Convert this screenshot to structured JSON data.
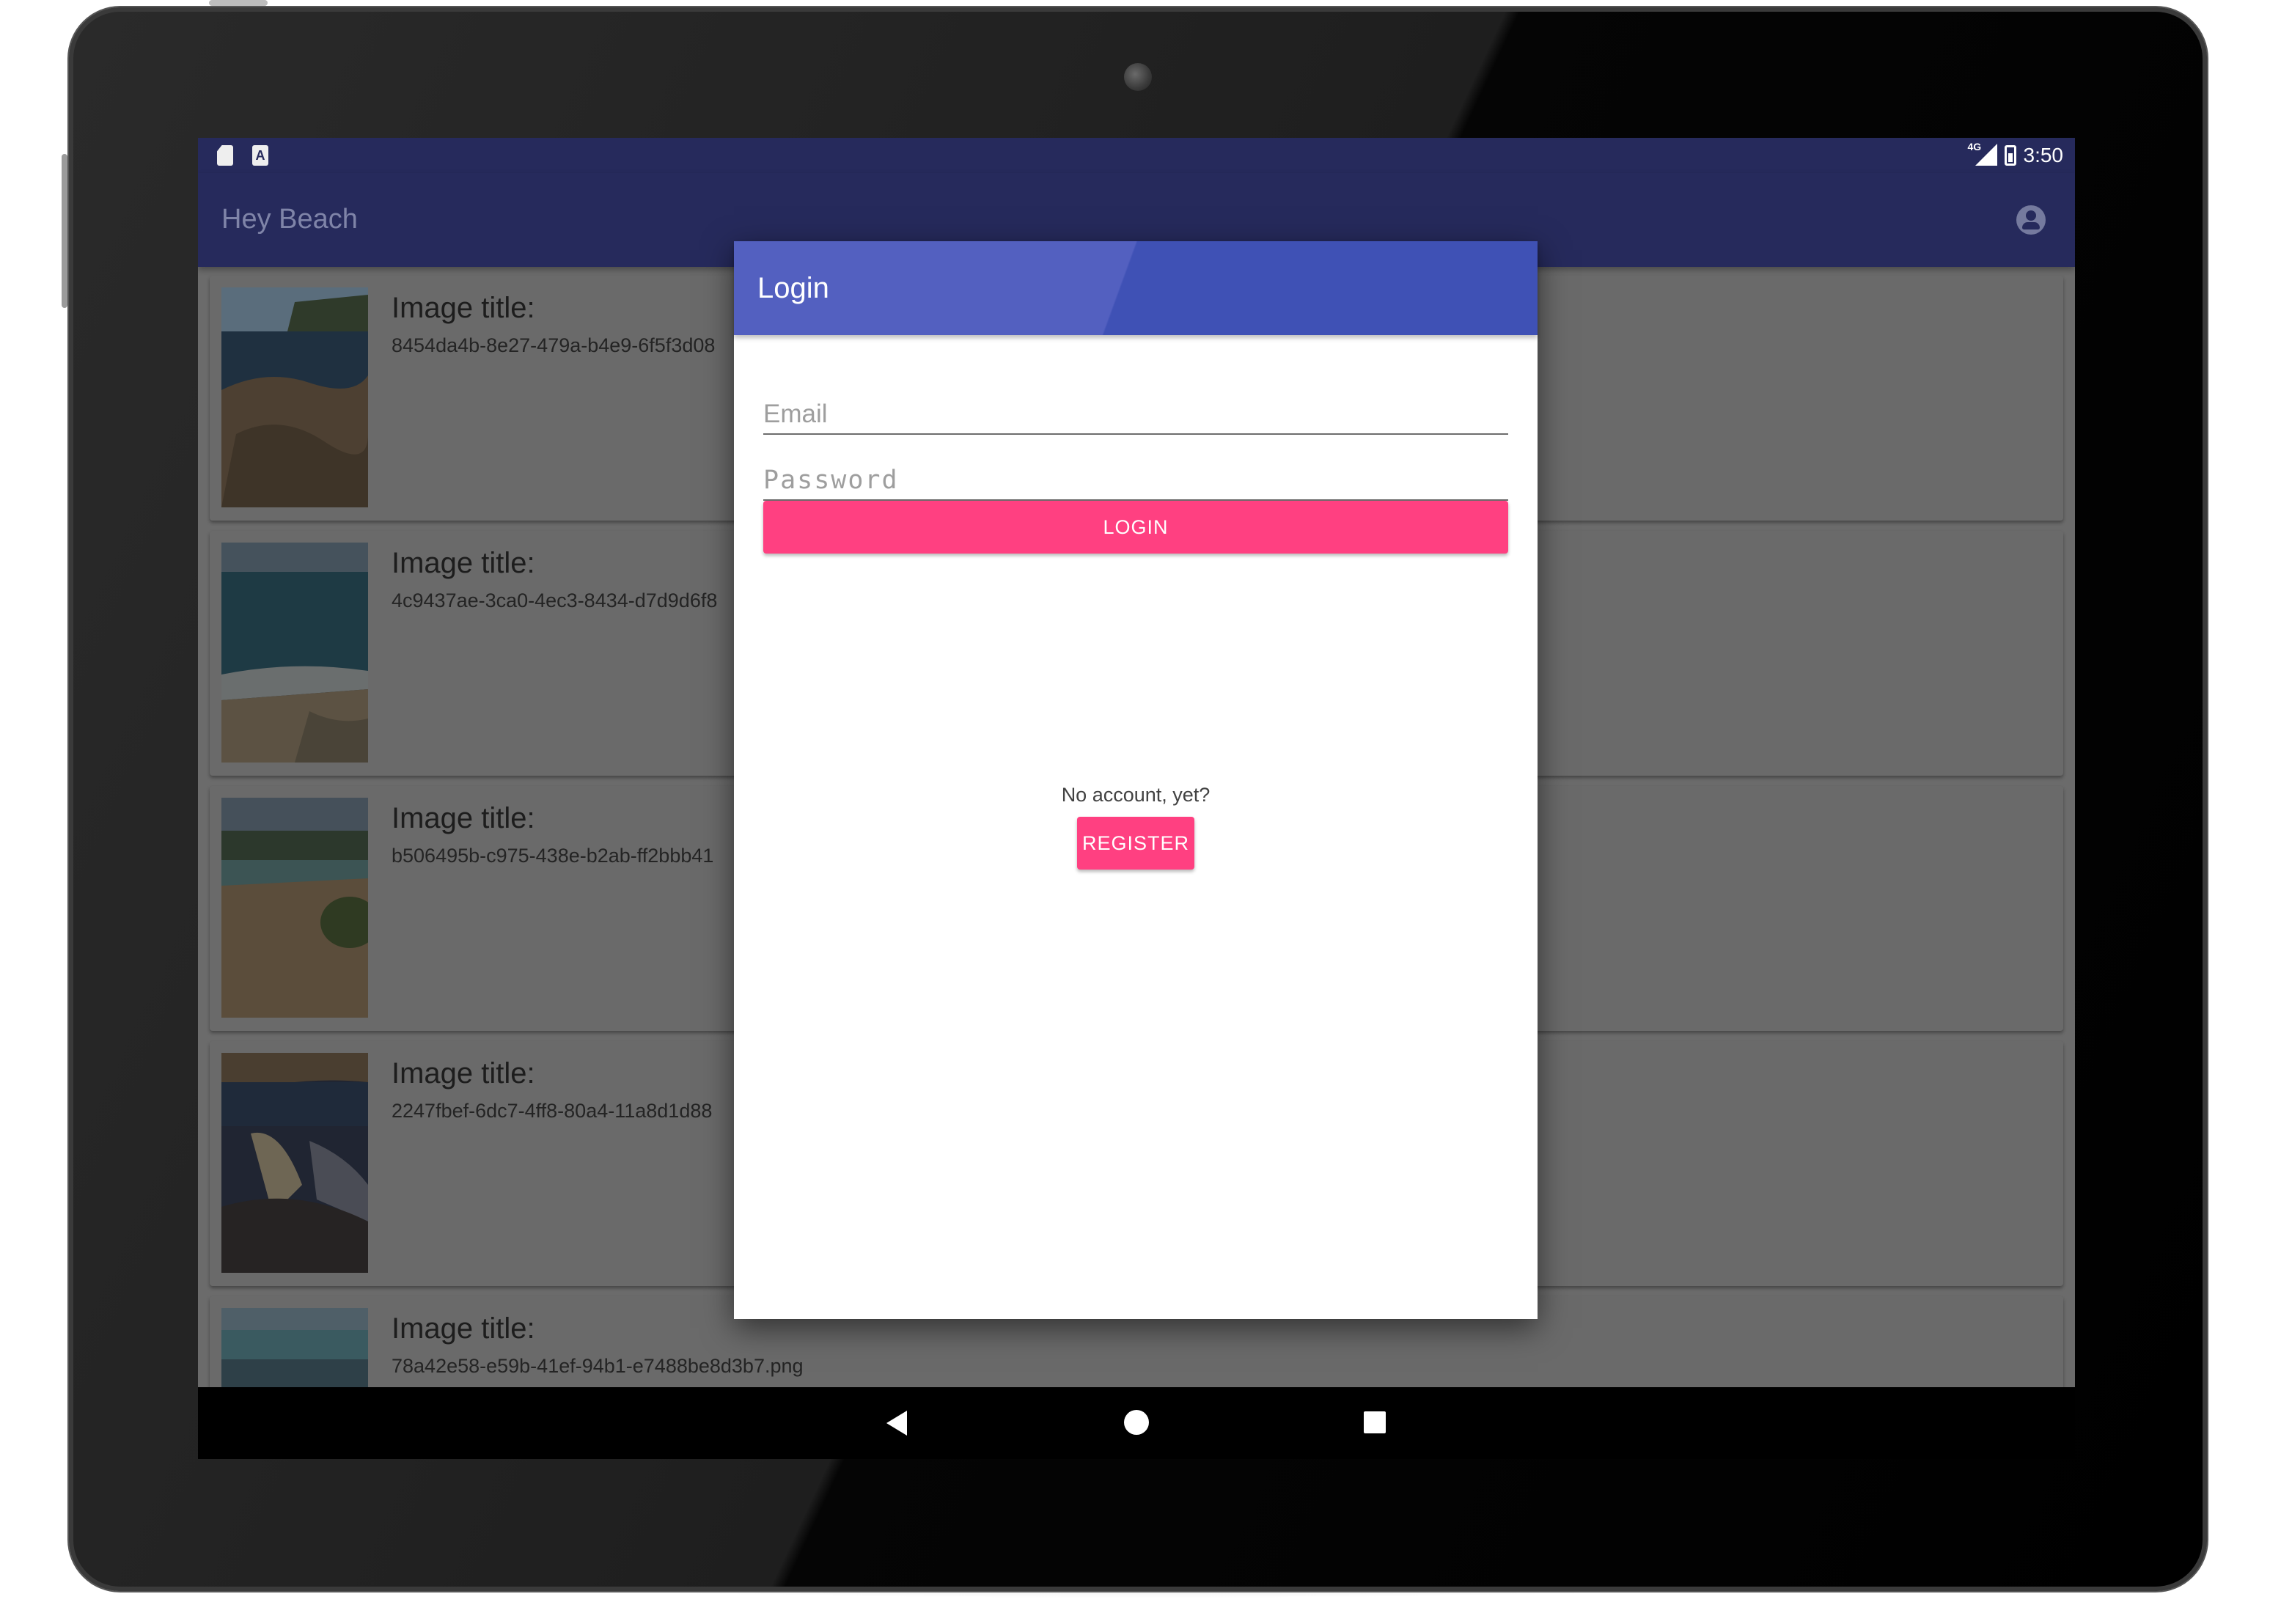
{
  "status_bar": {
    "time": "3:50",
    "network": "4G",
    "notification_icons": [
      "sd-card-icon",
      "text-icon"
    ],
    "text_icon_glyph": "A"
  },
  "app_bar": {
    "title": "Hey Beach",
    "action_icon": "account-circle-icon"
  },
  "list": {
    "items": [
      {
        "title": "Image title:",
        "filename": "8454da4b-8e27-479a-b4e9-6f5f3d08"
      },
      {
        "title": "Image title:",
        "filename": "4c9437ae-3ca0-4ec3-8434-d7d9d6f8"
      },
      {
        "title": "Image title:",
        "filename": "b506495b-c975-438e-b2ab-ff2bbb41"
      },
      {
        "title": "Image title:",
        "filename": "2247fbef-6dc7-4ff8-80a4-11a8d1d88"
      },
      {
        "title": "Image title:",
        "filename": "78a42e58-e59b-41ef-94b1-e7488be8d3b7.png"
      }
    ]
  },
  "dialog": {
    "title": "Login",
    "email": {
      "value": "",
      "placeholder": "Email"
    },
    "password": {
      "value": "",
      "placeholder": "Password"
    },
    "login_label": "LOGIN",
    "no_account_text": "No account, yet?",
    "register_label": "REGISTER"
  },
  "colors": {
    "primary": "#3f51b5",
    "primary_dark": "#262a5c",
    "accent": "#ff4081",
    "scrim": "#6b6b6b"
  },
  "nav_bar": {
    "icons": [
      "back-icon",
      "home-icon",
      "recent-apps-icon"
    ]
  }
}
